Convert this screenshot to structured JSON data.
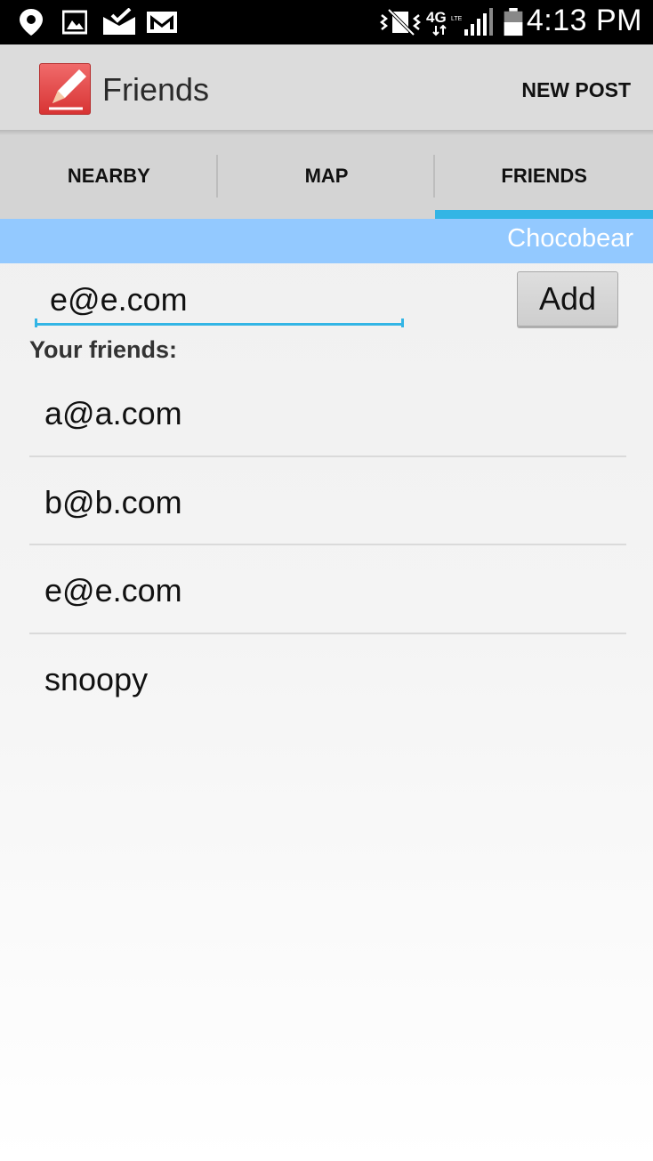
{
  "status_bar": {
    "time": "4:13 PM",
    "icons": [
      "location-icon",
      "image-icon",
      "mail-check-icon",
      "gmail-icon",
      "vibrate-icon",
      "network-4g-lte-icon",
      "signal-icon",
      "battery-icon"
    ]
  },
  "action_bar": {
    "title": "Friends",
    "new_post_label": "NEW POST",
    "app_icon": "pencil-icon"
  },
  "tabs": [
    {
      "label": "NEARBY",
      "selected": false
    },
    {
      "label": "MAP",
      "selected": false
    },
    {
      "label": "FRIENDS",
      "selected": true
    }
  ],
  "user_banner": {
    "name": "Chocobear"
  },
  "add_friend": {
    "input_value": "e@e.com",
    "add_label": "Add"
  },
  "friends": {
    "heading": "Your friends:",
    "items": [
      "a@a.com",
      "b@b.com",
      "e@e.com",
      "snoopy"
    ]
  },
  "colors": {
    "accent": "#33b5e5",
    "banner": "#93c9ff",
    "app_icon": "#e04848"
  }
}
